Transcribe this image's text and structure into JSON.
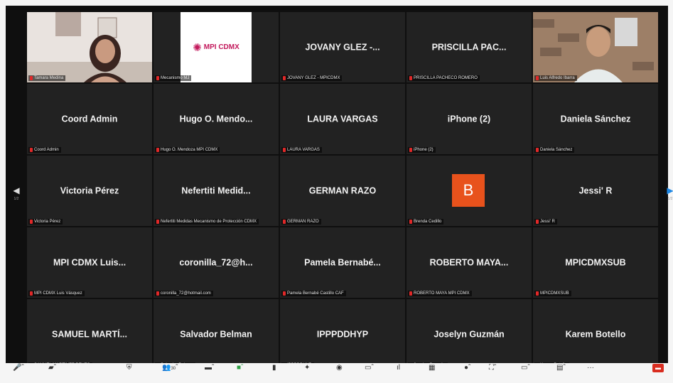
{
  "meeting": {
    "participant_count": "30"
  },
  "tiles": [
    {
      "name": "",
      "label": "Tamara Medina",
      "type": "video"
    },
    {
      "name": "",
      "label": "Mecanismo MJ",
      "type": "logo",
      "logo_text": "MPI CDMX"
    },
    {
      "name": "JOVANY GLEZ -...",
      "label": "JOVANY GLEZ - MPICDMX"
    },
    {
      "name": "PRISCILLA PAC...",
      "label": "PRISCILLA PACHECO ROMERO"
    },
    {
      "name": "",
      "label": "Luis Alfredo Ibarra",
      "type": "video2"
    },
    {
      "name": "Coord Admin",
      "label": "Coord Admin"
    },
    {
      "name": "Hugo O. Mendo...",
      "label": "Hugo O. Mendoza MPI CDMX"
    },
    {
      "name": "LAURA VARGAS",
      "label": "LAURA VARGAS"
    },
    {
      "name": "iPhone (2)",
      "label": "iPhone (2)"
    },
    {
      "name": "Daniela Sánchez",
      "label": "Daniela Sánchez"
    },
    {
      "name": "Victoria Pérez",
      "label": "Victoria Pérez"
    },
    {
      "name": "Nefertiti Medid...",
      "label": "Nefertiti Medidas Mecanismo de Protección CDMX"
    },
    {
      "name": "GERMAN RAZO",
      "label": "GERMAN RAZO"
    },
    {
      "name": "",
      "label": "Brenda Cedillo",
      "type": "avatar",
      "avatar_letter": "B"
    },
    {
      "name": "Jessi' R",
      "label": "Jessi' R"
    },
    {
      "name": "MPI CDMX Luis...",
      "label": "MPI CDMX Luis Vásquez"
    },
    {
      "name": "coronilla_72@h...",
      "label": "coronilla_72@hotmail.com"
    },
    {
      "name": "Pamela Bernabé...",
      "label": "Pamela Bernabé Castillo CAF"
    },
    {
      "name": "ROBERTO MAYA...",
      "label": "ROBERTO MAYA MPI CDMX"
    },
    {
      "name": "MPICDMXSUB",
      "label": "MPICDMXSUB"
    },
    {
      "name": "SAMUEL MARTÍ...",
      "label": "SAMUEL MARTÍNEZ REYES"
    },
    {
      "name": "Salvador Belman",
      "label": "Salvador Belman"
    },
    {
      "name": "IPPPDDHYP",
      "label": "IPPPDDHYP"
    },
    {
      "name": "Joselyn Guzmán",
      "label": "Joselyn Guzmán"
    },
    {
      "name": "Karem Botello",
      "label": "Karem Botello"
    }
  ],
  "colors": {
    "active_speaker_border": "#e7d44a",
    "tile_bg": "#222222",
    "avatar_bg": "#e8521c",
    "logo_accent": "#c2185b",
    "muted_mic": "#e02828",
    "next_page_arrow": "#1e88e5"
  },
  "icons": [
    "mic-icon",
    "video-icon",
    "security-icon",
    "participants-icon",
    "chat-icon",
    "share-screen-icon",
    "record-icon",
    "reactions-icon",
    "cc-icon",
    "polls-icon",
    "apps-icon",
    "whiteboard-icon",
    "more-icon",
    "end-icon"
  ]
}
